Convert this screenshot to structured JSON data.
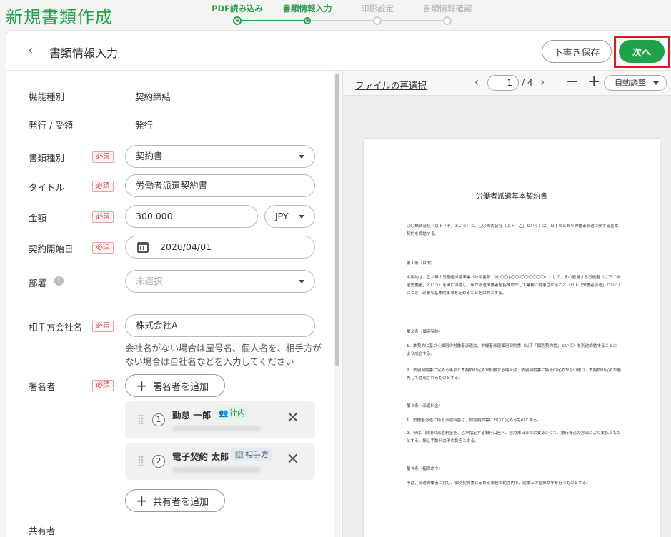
{
  "app": {
    "title": "新規書類作成"
  },
  "stepper": {
    "steps": [
      {
        "label": "PDF読み込み",
        "state": "done"
      },
      {
        "label": "書類情報入力",
        "state": "active"
      },
      {
        "label": "印影設定",
        "state": "pending"
      },
      {
        "label": "書類情報確認",
        "state": "pending"
      }
    ],
    "accent": "#2d9a4c"
  },
  "header": {
    "back_icon": "chevron-left-icon",
    "title": "書類情報入力",
    "draft_label": "下書き保存",
    "next_label": "次へ",
    "next_color": "#1fa34a",
    "highlight_color": "#e8141b"
  },
  "form": {
    "function_type": {
      "label": "機能種別",
      "value": "契約締結"
    },
    "direction": {
      "label": "発行 / 受領",
      "value": "発行"
    },
    "required_badge": "必須",
    "doc_type": {
      "label": "書類種別",
      "value": "契約書"
    },
    "title": {
      "label": "タイトル",
      "value": "労働者派遣契約書"
    },
    "amount": {
      "label": "金額",
      "value": "300,000",
      "currency": "JPY"
    },
    "start_date": {
      "label": "契約開始日",
      "value": "2026/04/01"
    },
    "department": {
      "label": "部署",
      "placeholder": "未選択"
    },
    "counterparty": {
      "label": "相手方会社名",
      "value": "株式会社A",
      "hint": "会社名がない場合は屋号名、個人名を、相手方がない場合は自社名などを入力してください"
    },
    "signers": {
      "label": "署名者",
      "add_label": "署名者を追加",
      "items": [
        {
          "order": "1",
          "name": "勤怠 一郎",
          "tag": "社内"
        },
        {
          "order": "2",
          "name": "電子契約 太郎",
          "tag": "相手方"
        }
      ]
    },
    "sharers": {
      "label": "共有者",
      "add_label": "共有者を追加"
    }
  },
  "preview": {
    "reselect_label": "ファイルの再選択",
    "page_current": "1",
    "page_total": "/ 4",
    "zoom_label": "自動調整",
    "doc": {
      "title": "労働者派遣基本契約書",
      "paragraphs": [
        "〇〇株式会社（以下「甲」という）と、〇〇株式会社（以下「乙」という）は、以下のとおり労働者派遣に関する基本契約を締結する。",
        "第１条（目的）",
        "本契約は、乙が甲の労働者派遣事業（許可番号：派[〇〇]-〇〇-〇〇〇〇〇〇）として、その雇用する労働者（以下「派遣労働者」という）を甲に派遣し、甲が派遣労働者を指揮命令して業務に従事させること（以下「労働者派遣」という）につき、必要な基本的事項を定めることを目的とする。",
        "第２条（個別契約）",
        "1．本契約に基づく個別の労働者派遣は、労働者派遣個別契約書（以下「個別契約書」という）を別途締結することにより成立する。",
        "2．個別契約書に定める事項と本契約の定めが抵触する場合は、個別契約書に特段の定めがない限り、本契約の定めが優先して適用されるものとする。",
        "第３条（派遣料金）",
        "1．労働者派遣に係る派遣料金は、個別契約書において定めるものとする。",
        "2．甲は、前項の派遣料金を、乙が指定する銀行口座へ、翌月末日までに支払いにて、銀行振込の方法により支払うものとする。振込手数料は甲の負担とする。",
        "第４条（指揮命令）",
        "甲は、派遣労働者に対し、個別契約書に定める業務の範囲内で、就業上の指揮命令を行うものとする。"
      ]
    }
  }
}
